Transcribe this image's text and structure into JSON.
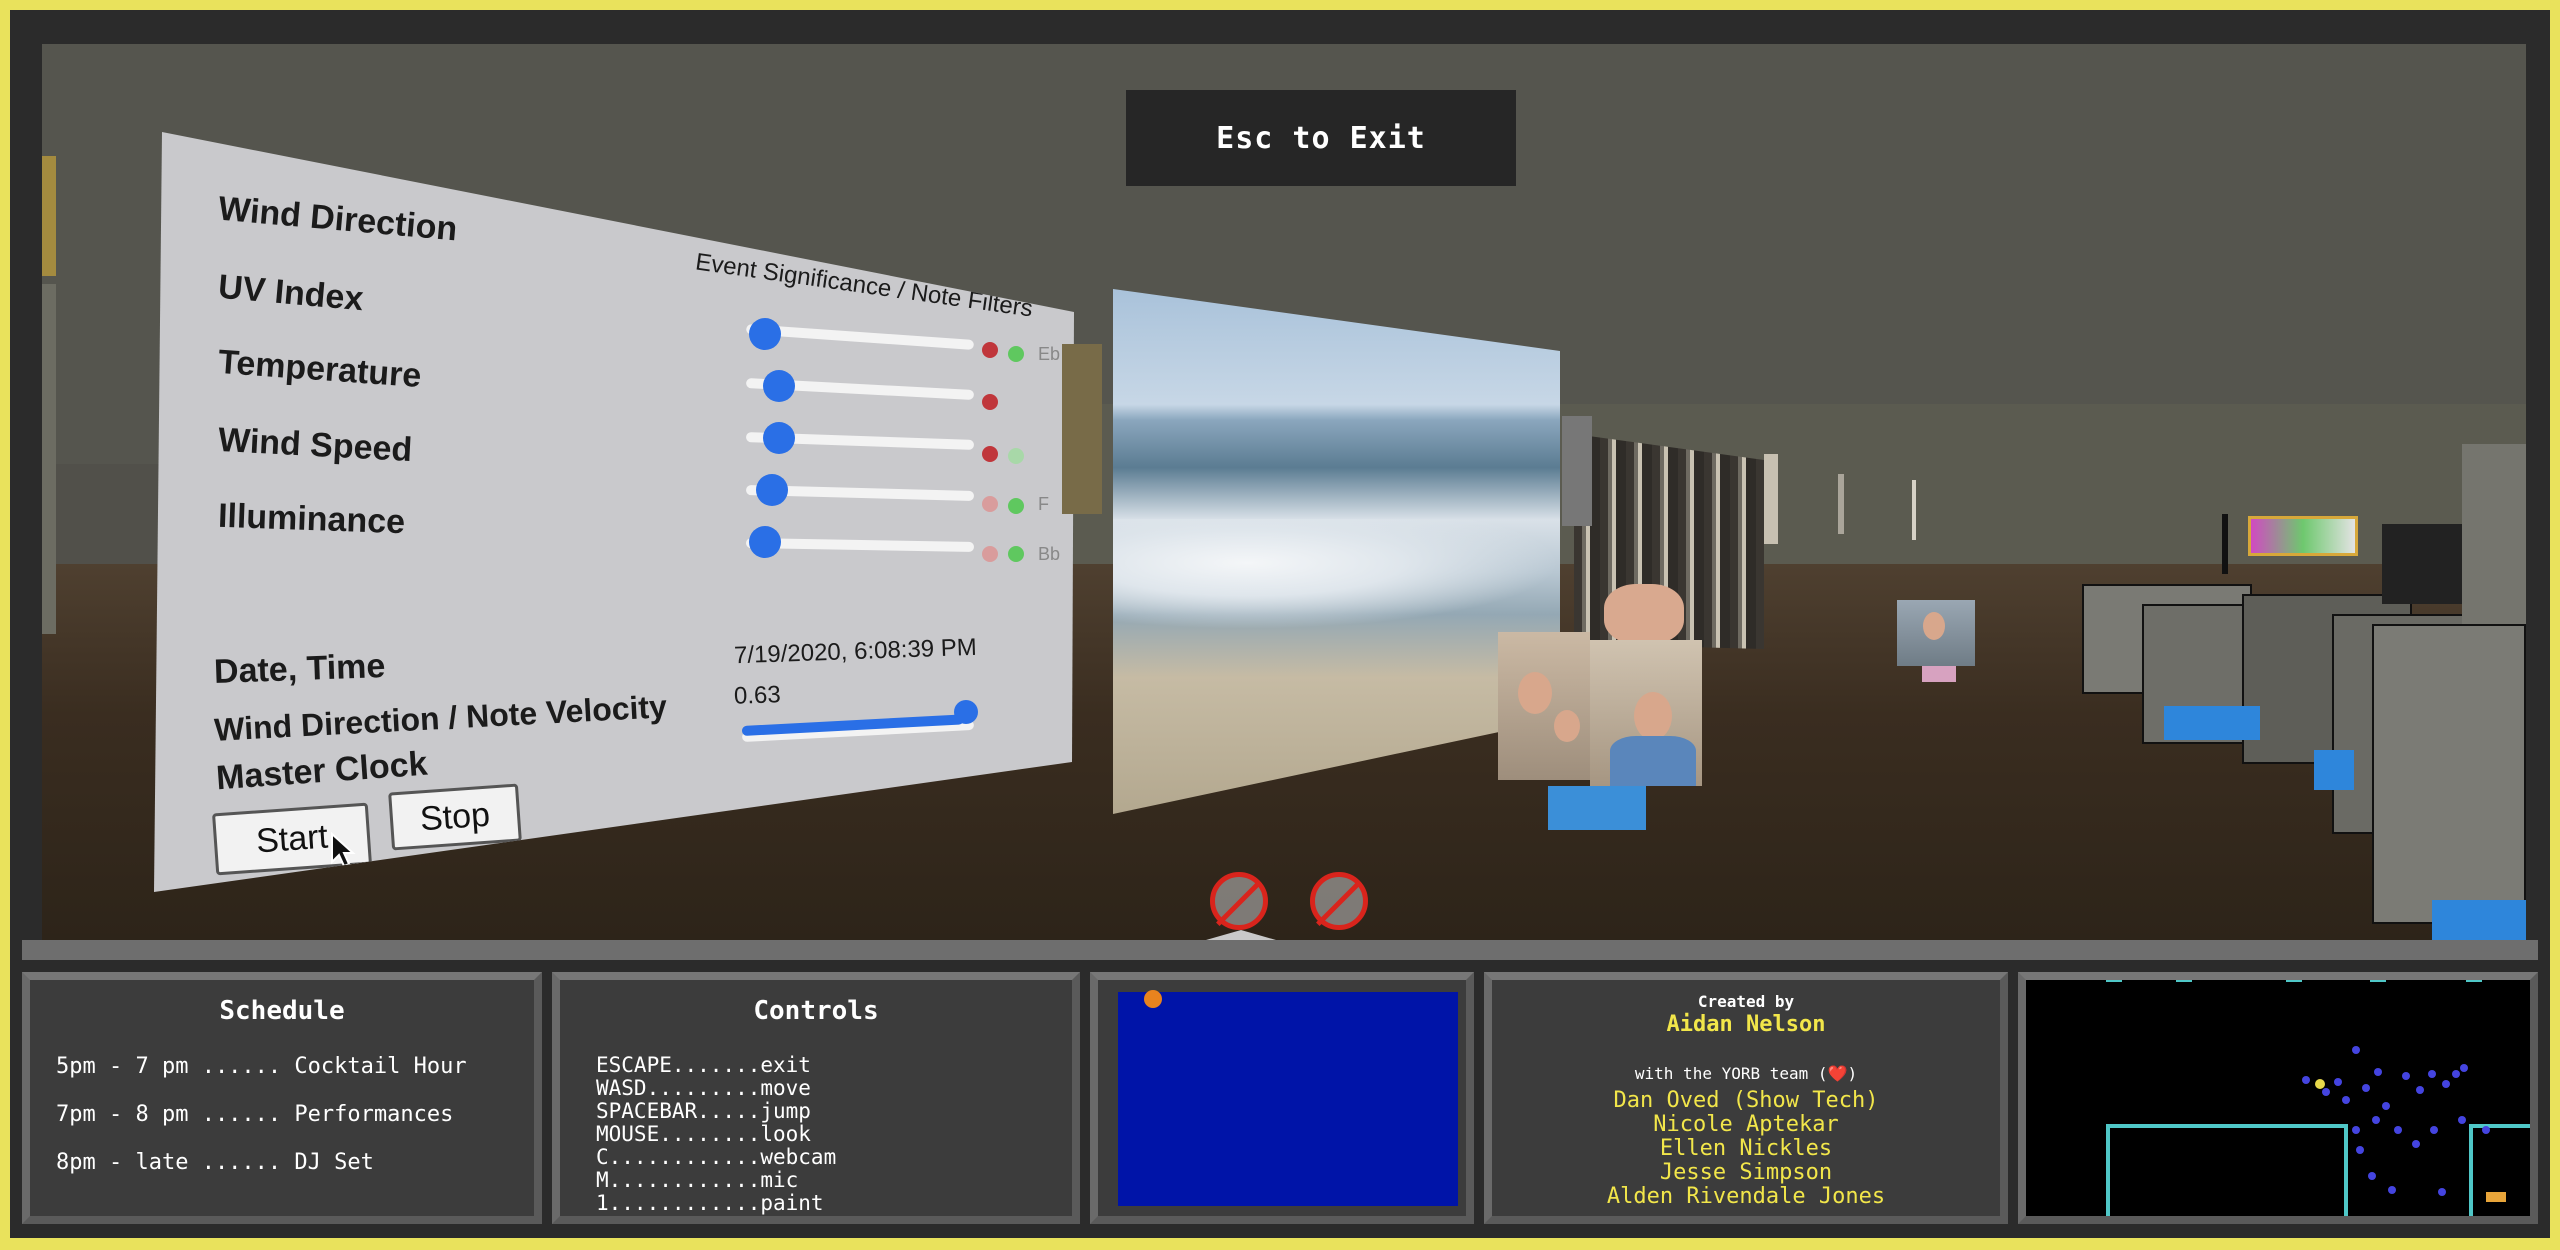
{
  "banner": {
    "text": "Esc to Exit"
  },
  "panel": {
    "rows": [
      {
        "label": "Wind Direction",
        "slider": 0.05,
        "dot_red": true,
        "dot_green": true,
        "note": "Eb"
      },
      {
        "label": "UV Index",
        "slider": 0.11,
        "dot_red": true,
        "dot_green": false,
        "note": ""
      },
      {
        "label": "Temperature",
        "slider": 0.11,
        "dot_red": true,
        "dot_green": false,
        "note": ""
      },
      {
        "label": "Wind Speed",
        "slider": 0.08,
        "dot_red": false,
        "dot_green": true,
        "note": "F"
      },
      {
        "label": "Illuminance",
        "slider": 0.05,
        "dot_red": false,
        "dot_green": true,
        "note": "Bb"
      }
    ],
    "filters_title": "Event Significance / Note Filters",
    "datetime_label": "Date, Time",
    "datetime_value": "7/19/2020, 6:08:39 PM",
    "velocity_label": "Wind Direction / Note Velocity",
    "velocity_value": "0.63",
    "clock_label": "Master Clock",
    "clock_slider": 1.0,
    "start_label": "Start",
    "stop_label": "Stop"
  },
  "status_icons": [
    "webcam-off-icon",
    "mic-off-icon"
  ],
  "schedule": {
    "title": "Schedule",
    "items": [
      "5pm - 7 pm ...... Cocktail Hour",
      "7pm - 8 pm ...... Performances",
      "8pm - late ...... DJ Set"
    ]
  },
  "controls": {
    "title": "Controls",
    "items": [
      "ESCAPE.......exit",
      "WASD.........move",
      "SPACEBAR.....jump",
      "MOUSE........look",
      "C............webcam",
      "M............mic",
      "1............paint"
    ]
  },
  "credits": {
    "created_by": "Created by",
    "author": "Aidan Nelson",
    "with_team": "with the YORB team (❤️)",
    "team": [
      "Dan Oved (Show Tech)",
      "Nicole Aptekar",
      "Ellen Nickles",
      "Jesse Simpson",
      "Alden Rivendale Jones"
    ]
  },
  "colors": {
    "frame_yellow": "#e9e25c",
    "slider_blue": "#2a6fe6",
    "credits_yellow": "#f2e64a",
    "paint_canvas": "#0014a8",
    "map_cyan": "#4fc7c7"
  }
}
